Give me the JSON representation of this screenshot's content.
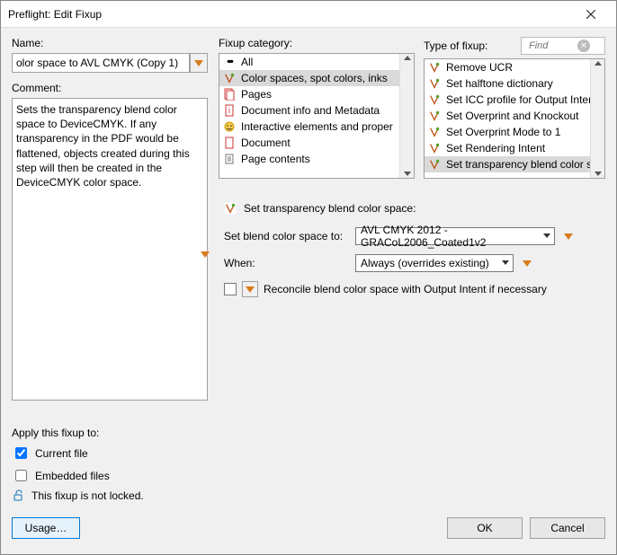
{
  "window": {
    "title": "Preflight: Edit Fixup"
  },
  "left": {
    "name_label": "Name:",
    "name_value": "olor space to AVL CMYK (Copy 1)",
    "comment_label": "Comment:",
    "comment_value": "Sets the transparency blend color space to DeviceCMYK. If any transparency in the PDF would be flattened, objects created during this step will then be created in the DeviceCMYK color space.",
    "apply_label": "Apply this fixup to:",
    "current_file": "Current file",
    "embedded_files": "Embedded files",
    "lock_text": "This fixup is not locked."
  },
  "lists": {
    "category_label": "Fixup category:",
    "type_label": "Type of fixup:",
    "find_placeholder": "Find",
    "categories": [
      {
        "label": "All",
        "icontype": "all"
      },
      {
        "label": "Color spaces, spot colors, inks",
        "icontype": "fixup",
        "selected": true
      },
      {
        "label": "Pages",
        "icontype": "pages"
      },
      {
        "label": "Document info and Metadata",
        "icontype": "docinfo"
      },
      {
        "label": "Interactive elements and proper",
        "icontype": "interactive"
      },
      {
        "label": "Document",
        "icontype": "document"
      },
      {
        "label": "Page contents",
        "icontype": "pagecontents"
      }
    ],
    "types": [
      {
        "label": "Remove UCR"
      },
      {
        "label": "Set halftone dictionary"
      },
      {
        "label": "Set ICC profile for Output Inter"
      },
      {
        "label": "Set Overprint and Knockout"
      },
      {
        "label": "Set Overprint Mode to 1"
      },
      {
        "label": "Set Rendering Intent"
      },
      {
        "label": "Set transparency blend color sp",
        "selected": true
      }
    ]
  },
  "detail": {
    "title": "Set transparency blend color space:",
    "field1_label": "Set blend color space to:",
    "field1_value": "AVL CMYK 2012 - GRACoL2006_Coated1v2",
    "field2_label": "When:",
    "field2_value": "Always (overrides existing)",
    "reconcile_label": "Reconcile blend color space with Output Intent if necessary"
  },
  "buttons": {
    "usage": "Usage…",
    "ok": "OK",
    "cancel": "Cancel"
  }
}
